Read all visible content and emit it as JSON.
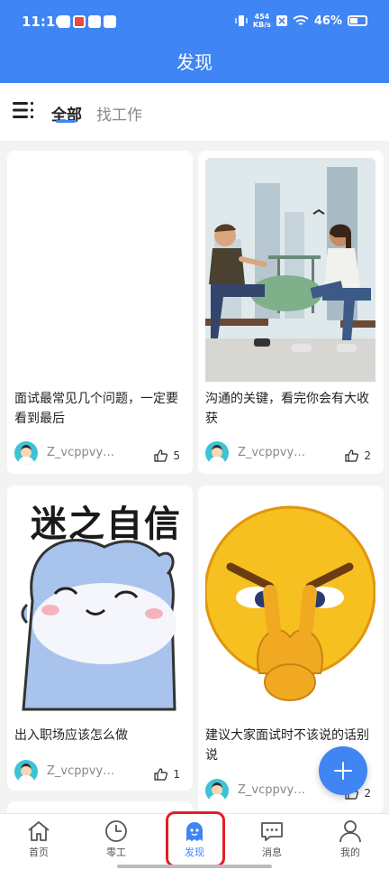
{
  "status_bar": {
    "time": "11:10",
    "speed_value": "454",
    "speed_unit": "KB/s",
    "battery": "46%"
  },
  "header": {
    "title": "发现"
  },
  "tabs": [
    {
      "label": "全部",
      "active": true
    },
    {
      "label": "找工作",
      "active": false
    }
  ],
  "posts": [
    {
      "title": "面试最常见几个问题，一定要看到最后",
      "author": "Z_vcppvy…",
      "likes": "5",
      "image": "none"
    },
    {
      "title": "沟通的关键，看完你会有大收获",
      "author": "Z_vcppvy…",
      "likes": "2",
      "image": "illustration-two-people-talking"
    },
    {
      "title": "出入职场应该怎么做",
      "author": "Z_vcppvy…",
      "likes": "1",
      "image": "sticker-blue-seal"
    },
    {
      "title": "建议大家面试时不该说的话别说",
      "author": "Z_vcppvy…",
      "likes": "2",
      "image": "emoji-thinking-face"
    }
  ],
  "meme_text": "迷之自信",
  "fab": {
    "icon": "plus-icon"
  },
  "bottom_nav": [
    {
      "label": "首页",
      "icon": "home-icon"
    },
    {
      "label": "零工",
      "icon": "clock-icon"
    },
    {
      "label": "发现",
      "icon": "discover-icon",
      "active": true
    },
    {
      "label": "消息",
      "icon": "message-icon"
    },
    {
      "label": "我的",
      "icon": "person-icon"
    }
  ],
  "colors": {
    "primary": "#3f85f3",
    "highlight": "#e51d25",
    "background": "#f3f3f3"
  }
}
